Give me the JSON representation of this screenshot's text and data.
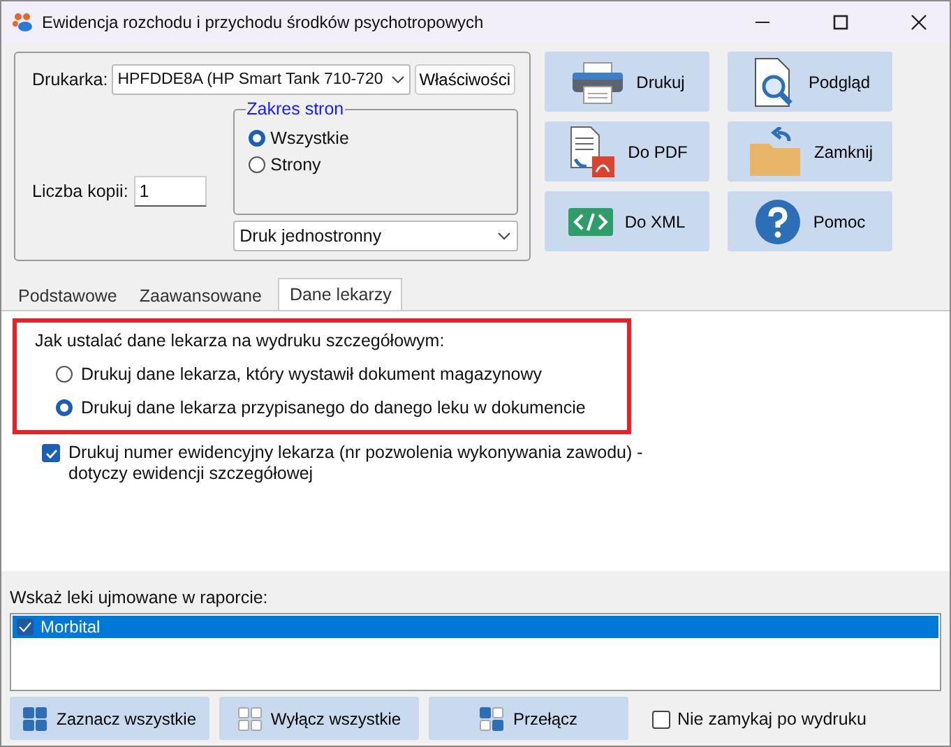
{
  "window": {
    "title": "Ewidencja rozchodu i przychodu środków psychotropowych"
  },
  "print": {
    "printer_label": "Drukarka:",
    "printer": "HPFDDE8A (HP Smart Tank 710-720",
    "properties_button": "Właściwości",
    "copies_label": "Liczba kopii:",
    "copies": "1",
    "range": {
      "title": "Zakres stron",
      "options": [
        {
          "label": "Wszystkie",
          "selected": true
        },
        {
          "label": "Strony",
          "selected": false
        }
      ]
    },
    "duplex": "Druk jednostronny"
  },
  "actions": [
    {
      "label": "Drukuj",
      "kind": "print"
    },
    {
      "label": "Podgląd",
      "kind": "preview"
    },
    {
      "label": "Do PDF",
      "kind": "pdf"
    },
    {
      "label": "Zamknij",
      "kind": "close"
    },
    {
      "label": "Do XML",
      "kind": "xml"
    },
    {
      "label": "Pomoc",
      "kind": "help"
    }
  ],
  "tabs": [
    {
      "label": "Podstawowe",
      "selected": false
    },
    {
      "label": "Zaawansowane",
      "selected": false
    },
    {
      "label": "Dane lekarzy",
      "selected": true
    }
  ],
  "doctor": {
    "question": "Jak ustalać dane lekarza na wydruku szczegółowym:",
    "options": [
      {
        "label": "Drukuj dane lekarza, który wystawił dokument magazynowy",
        "selected": false
      },
      {
        "label": "Drukuj dane lekarza przypisanego do danego leku w dokumencie",
        "selected": true
      }
    ],
    "registry": {
      "label": "Drukuj numer ewidencyjny lekarza (nr pozwolenia wykonywania zawodu) - dotyczy ewidencji szczegółowej",
      "checked": true
    }
  },
  "drugs": {
    "label": "Wskaż leki ujmowane w raporcie:",
    "items": [
      {
        "label": "Morbital",
        "checked": true,
        "selected": true
      }
    ]
  },
  "bottom_buttons": [
    {
      "label": "Zaznacz wszystkie",
      "kind": "all"
    },
    {
      "label": "Wyłącz wszystkie",
      "kind": "none"
    },
    {
      "label": "Przełącz",
      "kind": "toggle"
    }
  ],
  "keep_open": {
    "label": "Nie zamykaj po wydruku",
    "checked": false
  }
}
